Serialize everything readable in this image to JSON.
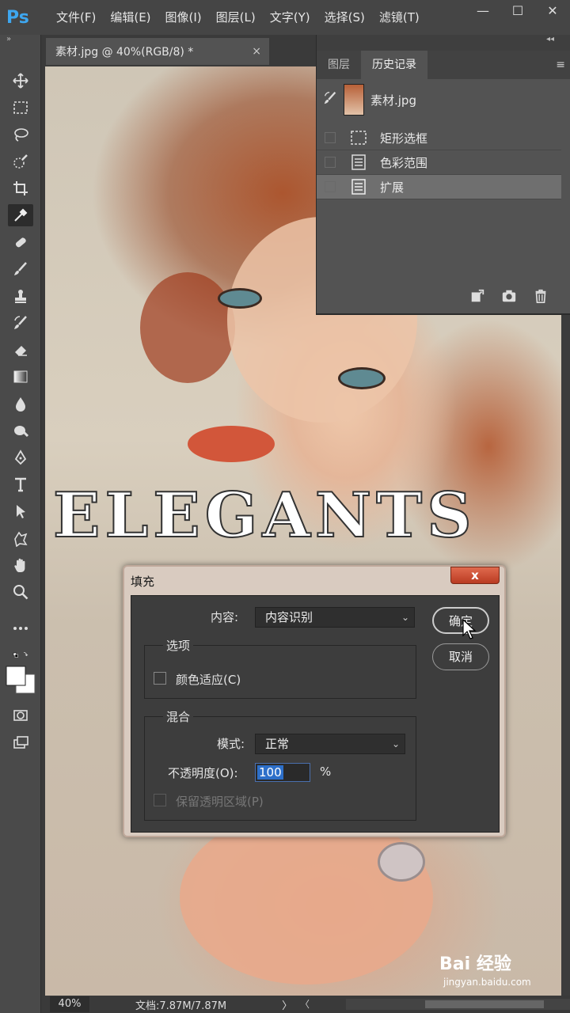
{
  "app": {
    "logo": "Ps"
  },
  "menu": [
    "文件(F)",
    "编辑(E)",
    "图像(I)",
    "图层(L)",
    "文字(Y)",
    "选择(S)",
    "滤镜(T)"
  ],
  "window_controls": {
    "minimize": "—",
    "maximize": "☐",
    "close": "✕"
  },
  "document": {
    "tab_title": "素材.jpg @ 40%(RGB/8) *",
    "tab_close": "×",
    "artwork_text": "ELEGANTS"
  },
  "toolbar": {
    "collapse": "»"
  },
  "tools": [
    "move-tool",
    "marquee-tool",
    "lasso-tool",
    "quick-select-tool",
    "crop-tool",
    "eyedropper-tool",
    "healing-tool",
    "brush-tool",
    "stamp-tool",
    "history-brush-tool",
    "eraser-tool",
    "gradient-tool",
    "blur-tool",
    "dodge-tool",
    "pen-tool",
    "type-tool",
    "path-select-tool",
    "shape-tool",
    "hand-tool",
    "zoom-tool",
    "more-tools"
  ],
  "history_panel": {
    "collapse": "◂◂",
    "tabs": [
      {
        "label": "图层",
        "active": false
      },
      {
        "label": "历史记录",
        "active": true
      }
    ],
    "menu_icon": "≡",
    "snapshot": "素材.jpg",
    "items": [
      {
        "label": "矩形选框",
        "icon": "marquee-icon",
        "selected": false
      },
      {
        "label": "色彩范围",
        "icon": "document-icon",
        "selected": false
      },
      {
        "label": "扩展",
        "icon": "document-icon",
        "selected": true
      }
    ],
    "bottom_icons": [
      "new-document-from-state-icon",
      "camera-icon",
      "trash-icon"
    ]
  },
  "fill_dialog": {
    "title": "填充",
    "close": "x",
    "content_label": "内容:",
    "content_value": "内容识别",
    "ok_label": "确定",
    "cancel_label": "取消",
    "options_title": "选项",
    "color_adapt_label": "颜色适应(C)",
    "blend_title": "混合",
    "mode_label": "模式:",
    "mode_value": "正常",
    "opacity_label": "不透明度(O):",
    "opacity_value": "100",
    "opacity_unit": "%",
    "preserve_label": "保留透明区域(P)"
  },
  "status": {
    "zoom": "40%",
    "doc_info": "文档:7.87M/7.87M",
    "arrow": "〉",
    "scroll_left": "〈"
  },
  "watermark": {
    "brand": "Bai 经验",
    "url": "jingyan.baidu.com"
  },
  "colors": {
    "accent": "#3ea7f0",
    "dialog_frame": "#d9cbc0",
    "close_button": "#c9472c",
    "selection": "#2d6fc9"
  }
}
